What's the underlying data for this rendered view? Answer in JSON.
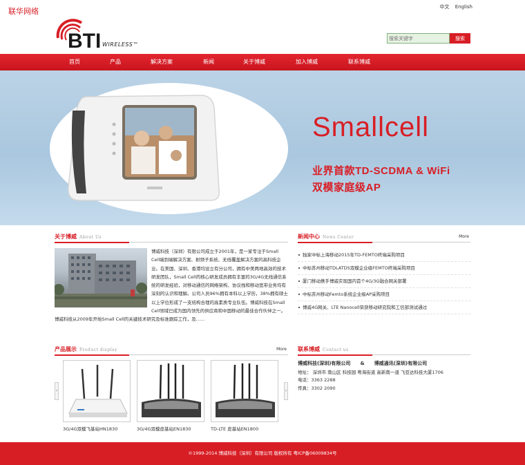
{
  "watermark": "联华网络",
  "lang": {
    "zh": "中文",
    "en": "English"
  },
  "logo": {
    "text": "BTI",
    "tagline": "WIRELESS™"
  },
  "search": {
    "placeholder": "搜索关键字",
    "button": "搜索"
  },
  "nav": {
    "items": [
      "首页",
      "产品",
      "解决方案",
      "新闻",
      "关于博威",
      "加入博威",
      "联系博威"
    ]
  },
  "banner": {
    "headline": "Smallcell",
    "line1": "业界首款TD-SCDMA & WiFi",
    "line2": "双模家庭级AP"
  },
  "about": {
    "title": "关于博威",
    "title_en": "About Us",
    "text": "博威科技（深圳）有限公司成立于2001年，是一家专注于Small Cell端到端解决方案、射频子系统、无线覆盖解决方案的高科技企业。在美国、深圳、香港均设立有分公司，拥有中美两地高效的技术研发团队，Small Cell的核心研发成员拥有丰富的3G/4G无线通信系统的研发经验，对移动通信的网络架构、协议栈和移动宽带业务均有深刻的认识和理解。公司人员96%拥有本科以上学历，38%拥有硕士以上学位形成了一支结构合理的高素质专业队伍。博威科技在Small Cell领域已成为国内领先的供应商和中国移动的最佳合作伙伴之一。博威科技从2009年开始Small Cell的关键技术研究及标准跟踪工作，及......"
  },
  "news": {
    "title": "新闻中心",
    "title_en": "News Center",
    "more": "More",
    "items": [
      "独家中标上海移动2015年TD-FEMTO终端采购项目",
      "中标苏州移动TDLATDS双模企业级FEMTO终端采购项目",
      "厦门移动携手博威实现国内首个4G/3G融合网关部署",
      "中标苏州移动Femto系统企业级AP采购项目",
      "博威4G网关、LTE Nanocell荣获移动研究院和工信部测试通过"
    ]
  },
  "products": {
    "title": "产品展示",
    "title_en": "Product display",
    "more": "More",
    "items": [
      {
        "label": "3G/4G双模飞基站HN1830"
      },
      {
        "label": "3G/4G双模皮基站EN1830"
      },
      {
        "label": "TD-LTE 皮基站EN1800"
      }
    ]
  },
  "contact": {
    "title": "联系博威",
    "title_en": "Contact us",
    "company1": "博威科技(深圳)有限公司",
    "amp": "&",
    "company2": "博威通讯(深圳)有限公司",
    "address": "地址： 深圳市 南山区 科技园 粤海街道 高新南一道 飞亚达科技大厦1706",
    "phone": "电话：3363 2288",
    "fax": "传真：3302 2090"
  },
  "footer": {
    "text": "©1999-2014 博威科技（深圳）有限公司 版权所有 粤ICP备06009834号"
  },
  "colors": {
    "brand_red": "#d81e25",
    "search_bg": "#e7f3e2"
  }
}
